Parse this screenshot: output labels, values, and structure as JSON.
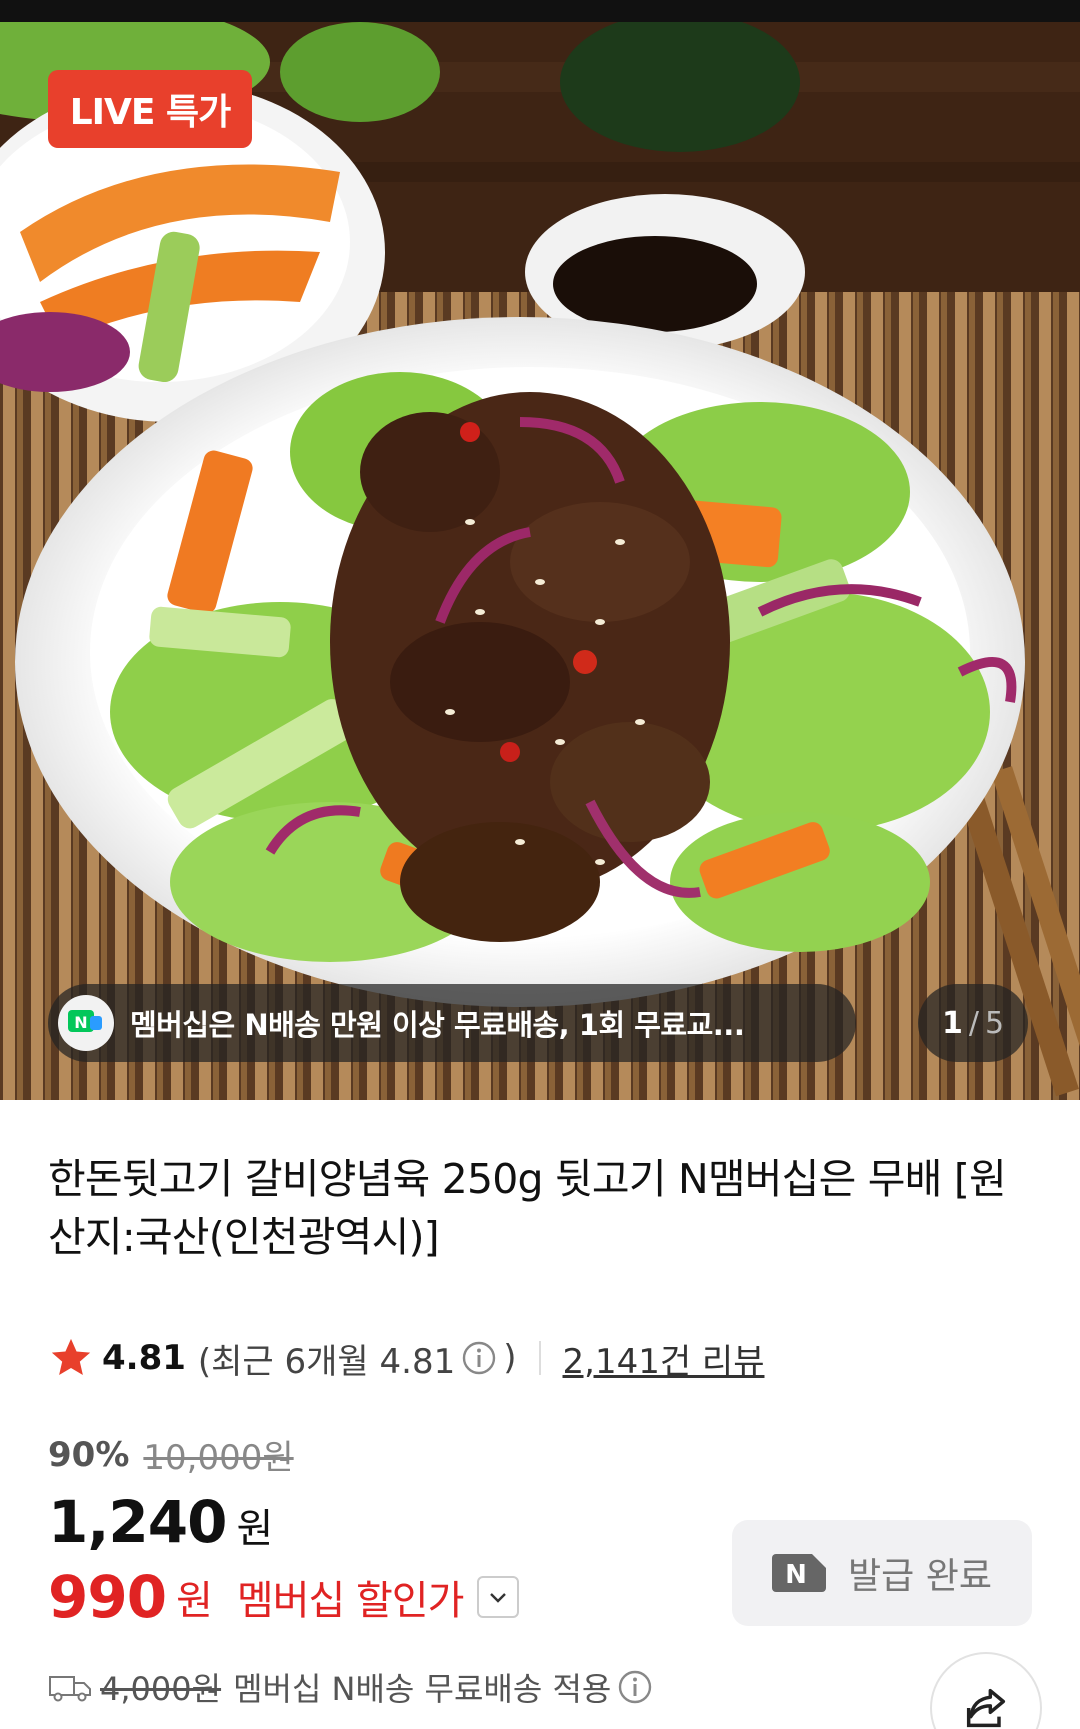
{
  "product": {
    "live_badge": "LIVE 특가",
    "notice": "멤버십은 N배송 만원 이상 무료배송, 1회 무료교...",
    "pager": {
      "current": "1",
      "separator": "/",
      "total": "5"
    },
    "title": "한돈뒷고기 갈비양념육 250g 뒷고기 N맴버십은 무배 [원산지:국산(인천광역시)]"
  },
  "rating": {
    "score": "4.81",
    "recent_prefix": "(최근 6개월 4.81",
    "recent_suffix": ")",
    "review_count": "2,141건 리뷰"
  },
  "price": {
    "discount_rate": "90%",
    "original": "10,000원",
    "sale": "1,240",
    "won": "원",
    "member_price": "990",
    "member_won": "원",
    "member_label": "멤버십 할인가"
  },
  "coupon": {
    "label": "발급 완료",
    "icon_text": "N"
  },
  "delivery": {
    "original_fee": "4,000원",
    "text": "멤버십 N배송 무료배송 적용"
  },
  "colors": {
    "accent_red": "#e02323",
    "badge_red": "#e8402c",
    "star": "#e8402c",
    "naver_green": "#03c75a"
  },
  "icons": [
    "star-icon",
    "info-icon",
    "chevron-down-icon",
    "naver-n-icon",
    "truck-icon",
    "share-icon"
  ]
}
